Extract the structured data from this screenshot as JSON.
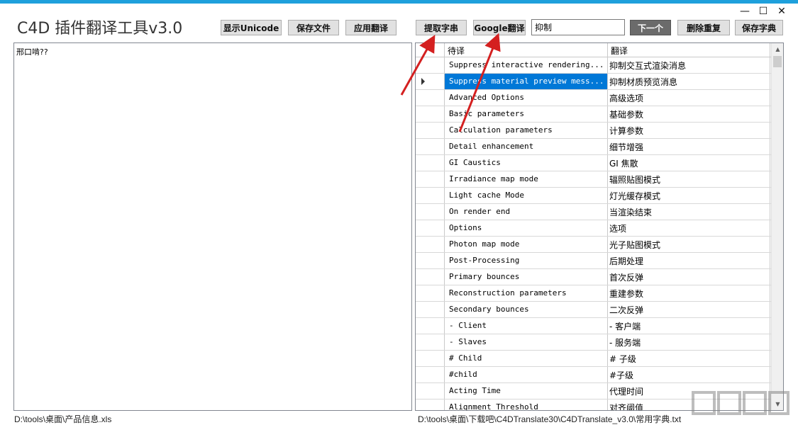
{
  "window": {
    "title": "C4D 插件翻译工具v3.0",
    "controls": {
      "minimize": "—",
      "maximize": "☐",
      "close": "✕"
    }
  },
  "toolbar": {
    "show_unicode": "显示Unicode",
    "save_file": "保存文件",
    "apply_translation": "应用翻译",
    "extract_strings": "提取字串",
    "google_translate": "Google翻译",
    "search_value": "抑制",
    "next": "下一个",
    "remove_duplicates": "删除重复",
    "save_dictionary": "保存字典"
  },
  "left_panel": {
    "text": "邢口啃??"
  },
  "grid": {
    "columns": [
      "待译",
      "翻译"
    ],
    "selected_index": 1,
    "rows": [
      {
        "src": "  Suppress interactive rendering...",
        "dst": "抑制交互式渲染消息"
      },
      {
        "src": "  Suppress material preview mess...",
        "dst": "抑制材质预览消息"
      },
      {
        "src": "Advanced Options",
        "dst": "高级选项"
      },
      {
        "src": "Basic parameters",
        "dst": "基础参数"
      },
      {
        "src": "Calculation parameters",
        "dst": "计算参数"
      },
      {
        "src": "Detail enhancement",
        "dst": "细节增强"
      },
      {
        "src": "GI Caustics",
        "dst": "GI 焦散"
      },
      {
        "src": "Irradiance map mode",
        "dst": "辐照贴图模式"
      },
      {
        "src": "Light cache Mode",
        "dst": "灯光缓存模式"
      },
      {
        "src": "On render end",
        "dst": "当渲染结束"
      },
      {
        "src": "Options",
        "dst": "选项"
      },
      {
        "src": "Photon map mode",
        "dst": "光子贴图模式"
      },
      {
        "src": "Post-Processing",
        "dst": "后期处理"
      },
      {
        "src": "Primary bounces",
        "dst": "首次反弹"
      },
      {
        "src": "Reconstruction parameters",
        "dst": "重建参数"
      },
      {
        "src": "Secondary bounces",
        "dst": "二次反弹"
      },
      {
        "src": "- Client",
        "dst": " - 客户端"
      },
      {
        "src": "- Slaves",
        "dst": " - 服务端"
      },
      {
        "src": "# Child",
        "dst": " # 子级"
      },
      {
        "src": "#child",
        "dst": " #子级"
      },
      {
        "src": "Acting Time",
        "dst": "代理时间"
      },
      {
        "src": "Alignment Threshold",
        "dst": "对齐阈值"
      }
    ]
  },
  "status": {
    "left_path": "D:\\tools\\桌面\\产品信息.xls",
    "right_path": "D:\\tools\\桌面\\下载吧\\C4DTranslate30\\C4DTranslate_v3.0\\常用字典.txt"
  },
  "colors": {
    "accent": "#1ea0dc",
    "selection": "#0078d7",
    "annotation_arrow": "#d42020"
  }
}
